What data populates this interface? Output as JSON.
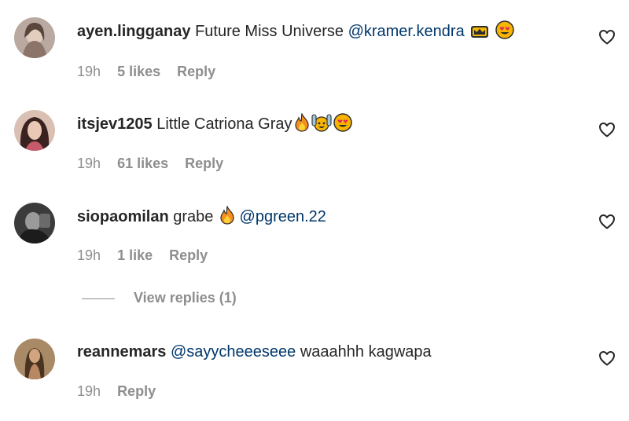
{
  "comments": [
    {
      "username": "ayen.lingganay",
      "text": "Future Miss Universe",
      "mention": "@kramer.kendra",
      "emojis": [
        "crown",
        "heart-eyes"
      ],
      "time": "19h",
      "likes": "5 likes",
      "reply": "Reply"
    },
    {
      "username": "itsjev1205",
      "text": "Little Catriona Gray",
      "mention": "",
      "emojis": [
        "fire",
        "raising-hands",
        "heart-eyes"
      ],
      "time": "19h",
      "likes": "61 likes",
      "reply": "Reply"
    },
    {
      "username": "siopaomilan",
      "text": "grabe",
      "mention": "@pgreen.22",
      "emojis": [
        "fire"
      ],
      "time": "19h",
      "likes": "1 like",
      "reply": "Reply",
      "view_replies": "View replies (1)"
    },
    {
      "username": "reannemars",
      "text": "waaahhh kagwapa",
      "mention": "@sayycheeeseee",
      "emojis": [],
      "time": "19h",
      "likes": "",
      "reply": "Reply"
    }
  ],
  "colors": {
    "text": "#262626",
    "mention": "#00376b",
    "meta": "#8e8e8e"
  }
}
